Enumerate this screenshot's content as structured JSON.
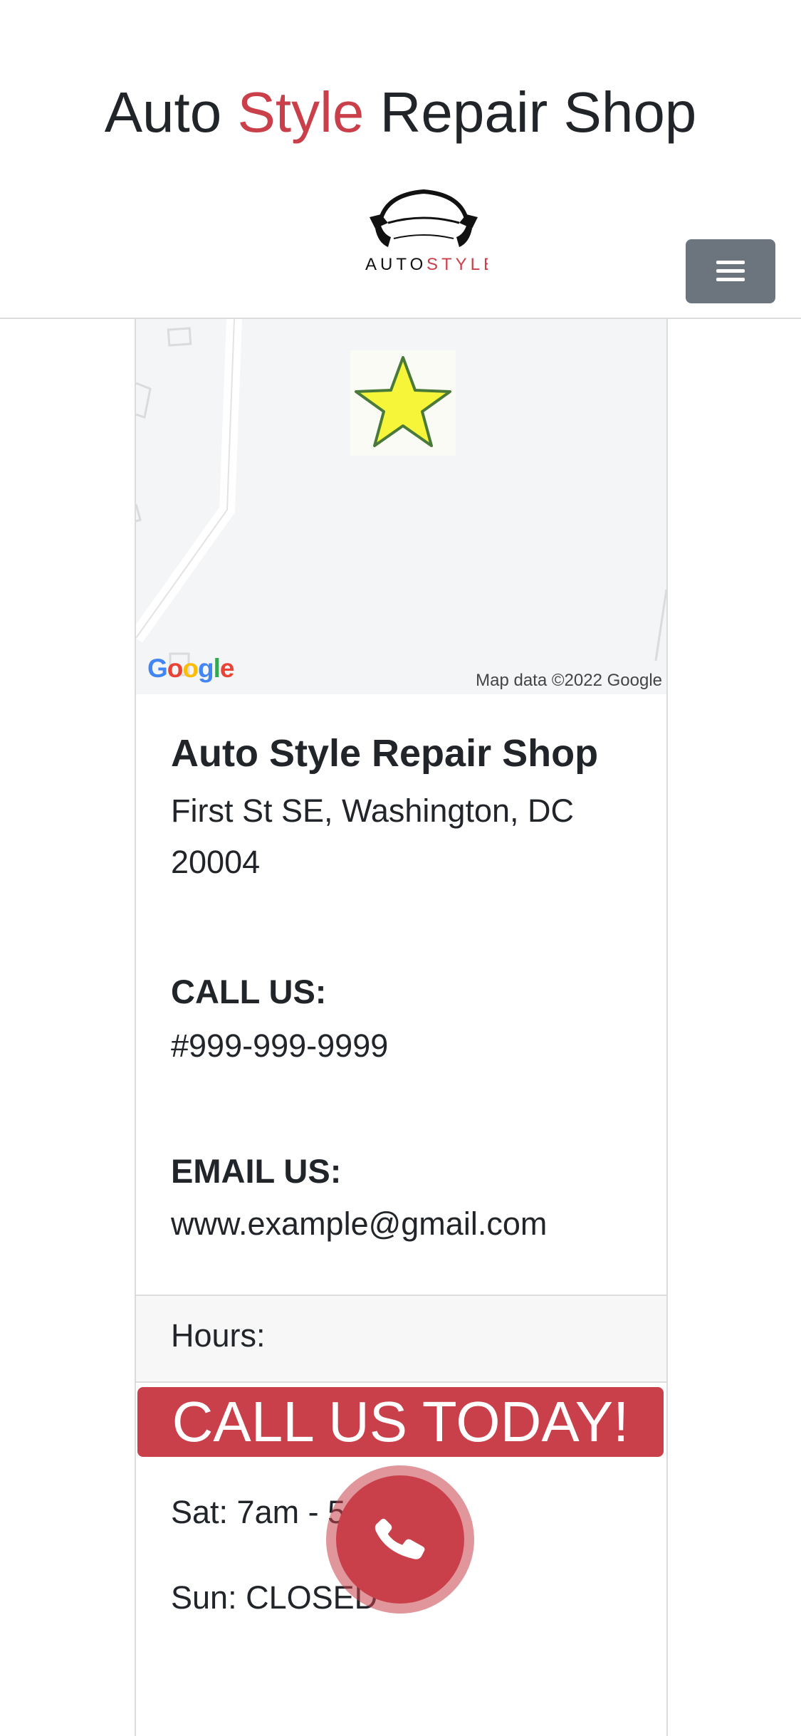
{
  "header": {
    "title_part1": "Auto ",
    "title_accent": "Style",
    "title_part2": " Repair Shop",
    "logo_text_dark": "AUTO",
    "logo_text_red": "STYLE",
    "accent_color": "#c9404a",
    "menu_icon": "hamburger-icon"
  },
  "map": {
    "marker_icon": "star-icon",
    "google_logo": "Google",
    "attribution": "Map data ©2022 Google"
  },
  "business": {
    "name": "Auto Style Repair Shop",
    "address_line1": "First St SE, Washington, DC",
    "address_line2": "20004",
    "call_label": "CALL US:",
    "phone": "#999-999-9999",
    "email_label": "EMAIL US:",
    "email": "www.example@gmail.com"
  },
  "hours": {
    "label": "Hours:",
    "sat": "Sat: 7am - 5",
    "sun": "Sun: CLOSED"
  },
  "cta": {
    "label": "CALL US TODAY!",
    "icon": "phone-icon"
  }
}
